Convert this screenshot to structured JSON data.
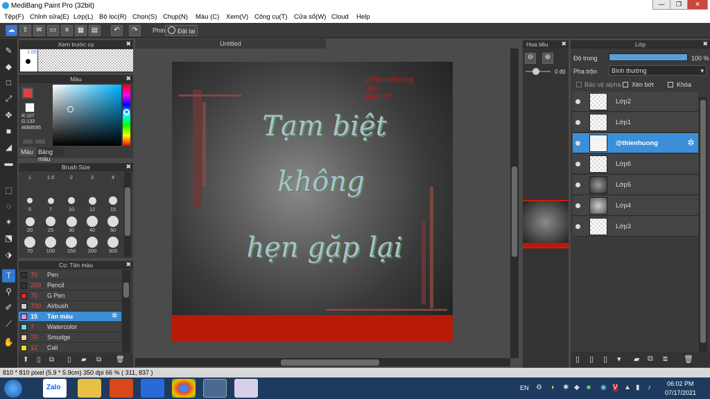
{
  "window": {
    "title": "MediBang Paint Pro (32bit)",
    "min": "—",
    "max": "❐",
    "close": "✕"
  },
  "menu": [
    "Tệp(F)",
    "Chỉnh sửa(E)",
    "Lớp(L)",
    "Bộ lọc(R)",
    "Chọn(S)",
    "Chụp(N)",
    "Màu (C)",
    "Xem(V)",
    "Công cụ(T)",
    "Cửa sổ(W)",
    "Cloud",
    "Help"
  ],
  "toolbar": {
    "key_label": "Phím",
    "reset_label": "Đặt lại"
  },
  "brush_preview": {
    "title": "Xem trước cọ",
    "size": "1.09"
  },
  "color_panel": {
    "title": "Màu",
    "r": "R:107",
    "g": "G:133",
    "b": "B:149",
    "hex": "#6B8595",
    "tab1": "Màu",
    "tab2": "Bảng màu",
    "fg": "#6b8595",
    "bg": "#ffffff"
  },
  "brush_size": {
    "title": "Brush Size",
    "sizes": [
      "1",
      "1.5",
      "2",
      "3",
      "4",
      "5",
      "7",
      "10",
      "12",
      "15",
      "20",
      "25",
      "30",
      "40",
      "50",
      "70",
      "100",
      "150",
      "200",
      "300"
    ]
  },
  "brush_list": {
    "title": "Cọ: Tán màu",
    "items": [
      {
        "size": "70",
        "name": "Pen",
        "color": "#333333"
      },
      {
        "size": "200",
        "name": "Pencil",
        "color": "#333333"
      },
      {
        "size": "70",
        "name": "G Pen",
        "color": "#e02020"
      },
      {
        "size": "700",
        "name": "Airbush",
        "color": "#cccccc"
      },
      {
        "size": "15",
        "name": "Tán màu",
        "color": "#e090e0",
        "selected": true
      },
      {
        "size": "7",
        "name": "Watercolor",
        "color": "#70d0f0"
      },
      {
        "size": "70",
        "name": "Smudge",
        "color": "#f0d0b0"
      },
      {
        "size": "12",
        "name": "Cali",
        "color": "#f0e020"
      }
    ]
  },
  "canvas": {
    "tab": "Untitled",
    "watermark1": "@thienhuong",
    "watermark2": "-Ru-",
    "watermark3": "#hd247",
    "line1": "Tạm biệt",
    "line2": "không",
    "line3": "hẹn gặp lại"
  },
  "navigator": {
    "title": "Hoa tiêu",
    "angle": "0 độ"
  },
  "layers": {
    "title": "Lớp",
    "opacity_label": "Độ trong",
    "opacity_value": "100 %",
    "blend_label": "Pha trộn",
    "blend_value": "Bình thường",
    "protect_alpha": "Bảo vệ alpha",
    "clip": "Xén bớt",
    "lock": "Khóa",
    "items": [
      {
        "name": "Lớp2"
      },
      {
        "name": "Lớp1"
      },
      {
        "name": "@thienhuong",
        "selected": true
      },
      {
        "name": "Lớp6"
      },
      {
        "name": "Lớp5"
      },
      {
        "name": "Lớp4"
      },
      {
        "name": "Lớp3"
      }
    ]
  },
  "status": {
    "text": "810 * 810 pixel  (5.9 * 5.9cm)  350 dpi  66 %  ( 311, 837 )"
  },
  "taskbar": {
    "zalo": "Zalo",
    "lang": "EN",
    "time": "06:02 PM",
    "date": "07/17/2021"
  }
}
